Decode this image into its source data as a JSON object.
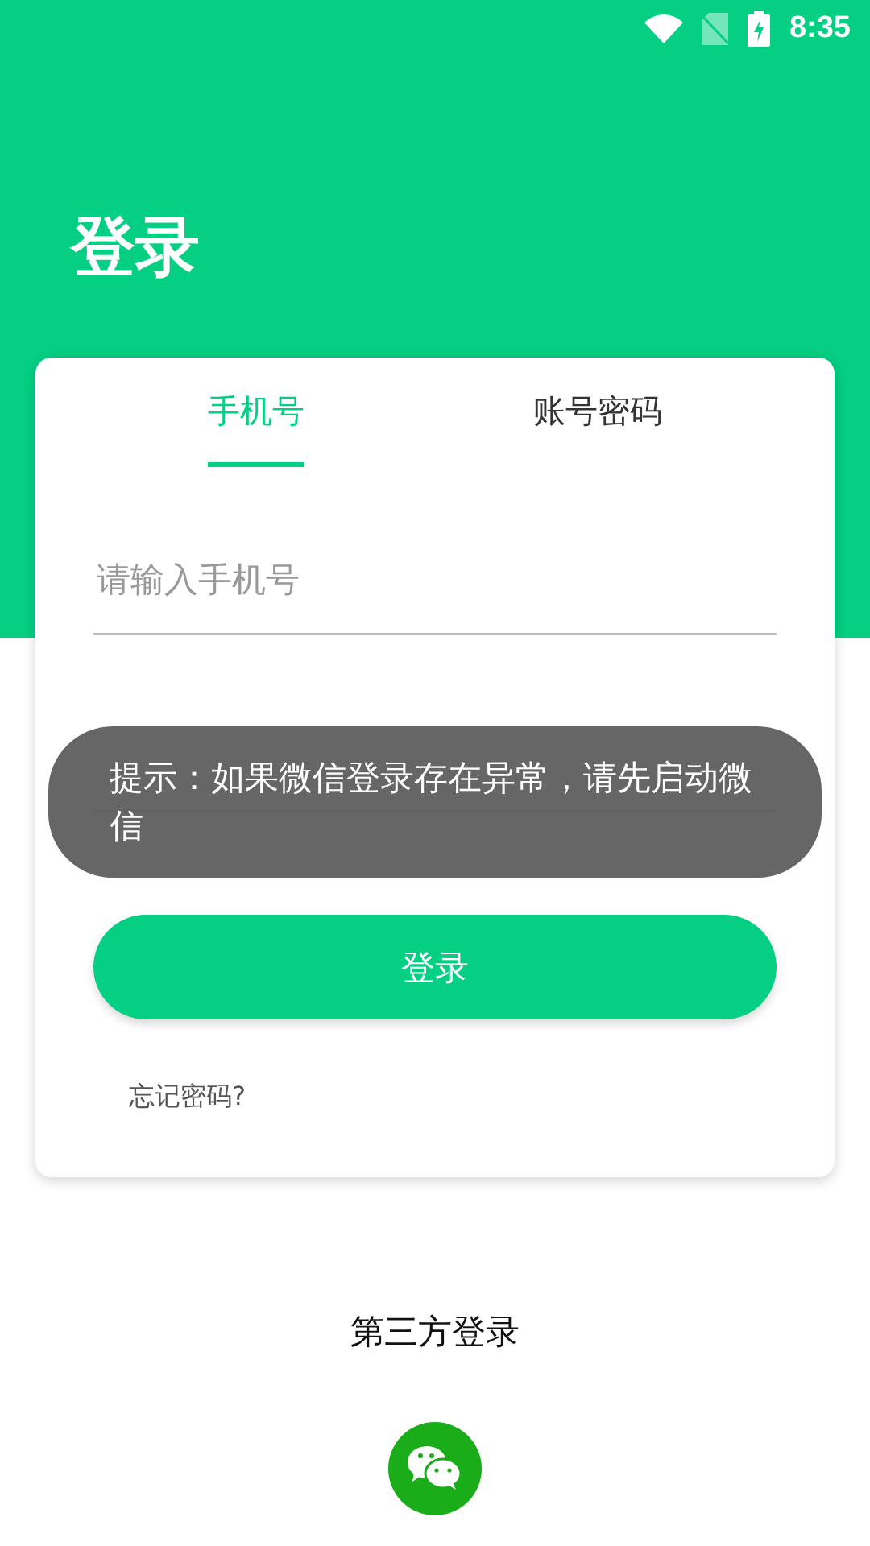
{
  "status_bar": {
    "time": "8:35"
  },
  "title": "登录",
  "tabs": [
    {
      "label": "手机号",
      "selected": true
    },
    {
      "label": "账号密码",
      "selected": false
    }
  ],
  "phone_field": {
    "placeholder": "请输入手机号"
  },
  "login_button": "登录",
  "forgot_link": "忘记密码?",
  "third_party": {
    "label": "第三方登录"
  },
  "toast": "提示：如果微信登录存在异常，请先启动微信"
}
